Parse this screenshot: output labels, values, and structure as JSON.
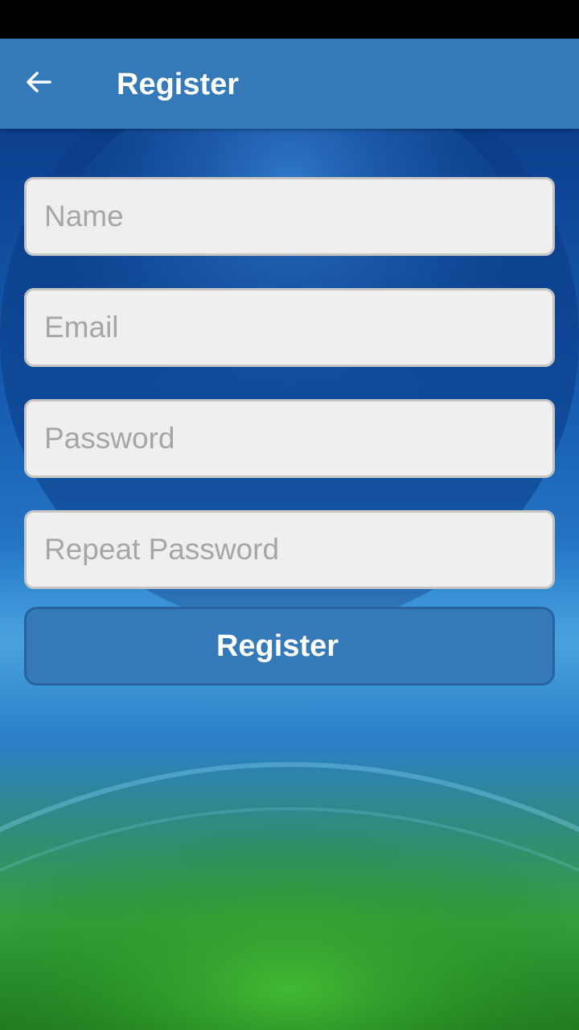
{
  "status_bar": {},
  "app_bar": {
    "title": "Register",
    "back_icon": "arrow-left-icon",
    "color": "#357ab8"
  },
  "background": {
    "description_icon": "stadium-background",
    "top_color": "#0b3f8f",
    "bottom_color": "#2e9a2a"
  },
  "form": {
    "name": {
      "placeholder": "Name",
      "value": ""
    },
    "email": {
      "placeholder": "Email",
      "value": ""
    },
    "password": {
      "placeholder": "Password",
      "value": ""
    },
    "repeat_password": {
      "placeholder": "Repeat Password",
      "value": ""
    },
    "submit_label": "Register",
    "button_color": "#357ab8"
  }
}
